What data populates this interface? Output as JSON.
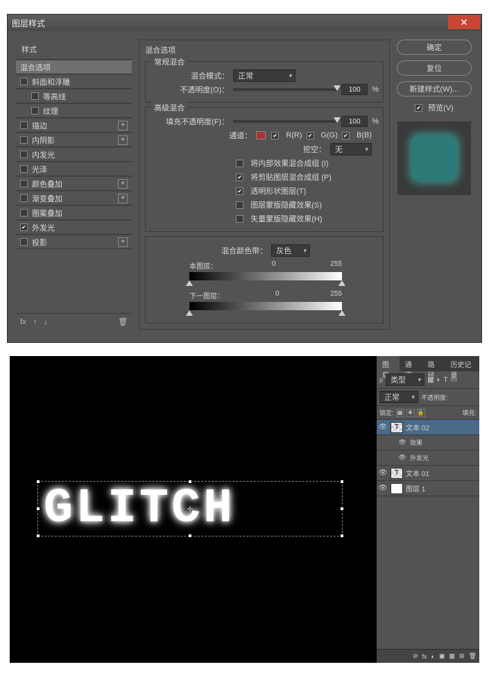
{
  "dialog": {
    "title": "图层样式",
    "styles_header": "样式",
    "style_rows": [
      {
        "label": "混合选项",
        "checked": null,
        "selected": true,
        "indent": false,
        "add": false
      },
      {
        "label": "斜面和浮雕",
        "checked": false,
        "indent": false,
        "add": false
      },
      {
        "label": "等高线",
        "checked": false,
        "indent": true,
        "add": false
      },
      {
        "label": "纹理",
        "checked": false,
        "indent": true,
        "add": false
      },
      {
        "label": "描边",
        "checked": false,
        "indent": false,
        "add": true
      },
      {
        "label": "内阴影",
        "checked": false,
        "indent": false,
        "add": true
      },
      {
        "label": "内发光",
        "checked": false,
        "indent": false,
        "add": false
      },
      {
        "label": "光泽",
        "checked": false,
        "indent": false,
        "add": false
      },
      {
        "label": "颜色叠加",
        "checked": false,
        "indent": false,
        "add": true
      },
      {
        "label": "渐变叠加",
        "checked": false,
        "indent": false,
        "add": true
      },
      {
        "label": "图案叠加",
        "checked": false,
        "indent": false,
        "add": false
      },
      {
        "label": "外发光",
        "checked": true,
        "indent": false,
        "add": false
      },
      {
        "label": "投影",
        "checked": false,
        "indent": false,
        "add": true
      }
    ],
    "foot_fx": "fx",
    "opts": {
      "title": "混合选项",
      "normal_group": "常规混合",
      "blend_mode_label": "混合模式：",
      "blend_mode_value": "正常",
      "opacity_label": "不透明度(O)：",
      "opacity_value": "100",
      "pct": "%",
      "adv_group": "高级混合",
      "fill_label": "填充不透明度(F)：",
      "fill_value": "100",
      "channels_label": "通道：",
      "ch_r": "R(R)",
      "ch_g": "G(G)",
      "ch_b": "B(B)",
      "knockout_label": "挖空：",
      "knockout_value": "无",
      "adv_checks": [
        {
          "label": "将内部效果混合成组 (I)",
          "checked": false
        },
        {
          "label": "将剪贴图层混合成组 (P)",
          "checked": true
        },
        {
          "label": "透明形状图层(T)",
          "checked": true
        },
        {
          "label": "图层蒙版隐藏效果(S)",
          "checked": false
        },
        {
          "label": "矢量蒙版隐藏效果(H)",
          "checked": false
        }
      ],
      "blendif_label": "混合颜色带：",
      "blendif_value": "灰色",
      "this_layer": "本图层：",
      "under_layer": "下一图层：",
      "range_lo": "0",
      "range_hi": "255"
    },
    "buttons": {
      "ok": "确定",
      "cancel": "复位",
      "new": "新建样式(W)...",
      "preview": "预览(V)"
    }
  },
  "bottom": {
    "text": "GLITCH",
    "tabs": [
      "图层",
      "通道",
      "路径",
      "历史记录"
    ],
    "kind_label": "类型",
    "blend": "正常",
    "opacity_label": "不透明度:",
    "lock_label": "锁定:",
    "fill_label": "填充:",
    "layers": [
      {
        "name": "文本 02",
        "selected": true,
        "thumb": "T"
      },
      {
        "name": "效果",
        "sub": true
      },
      {
        "name": "外发光",
        "sub": true
      },
      {
        "name": "文本 01",
        "thumb": "T"
      },
      {
        "name": "图层 1",
        "thumb": "solid"
      }
    ],
    "foot_icons": [
      "⊘",
      "fx",
      "◐",
      "▣",
      "▦",
      "⊞",
      "🗑"
    ]
  }
}
